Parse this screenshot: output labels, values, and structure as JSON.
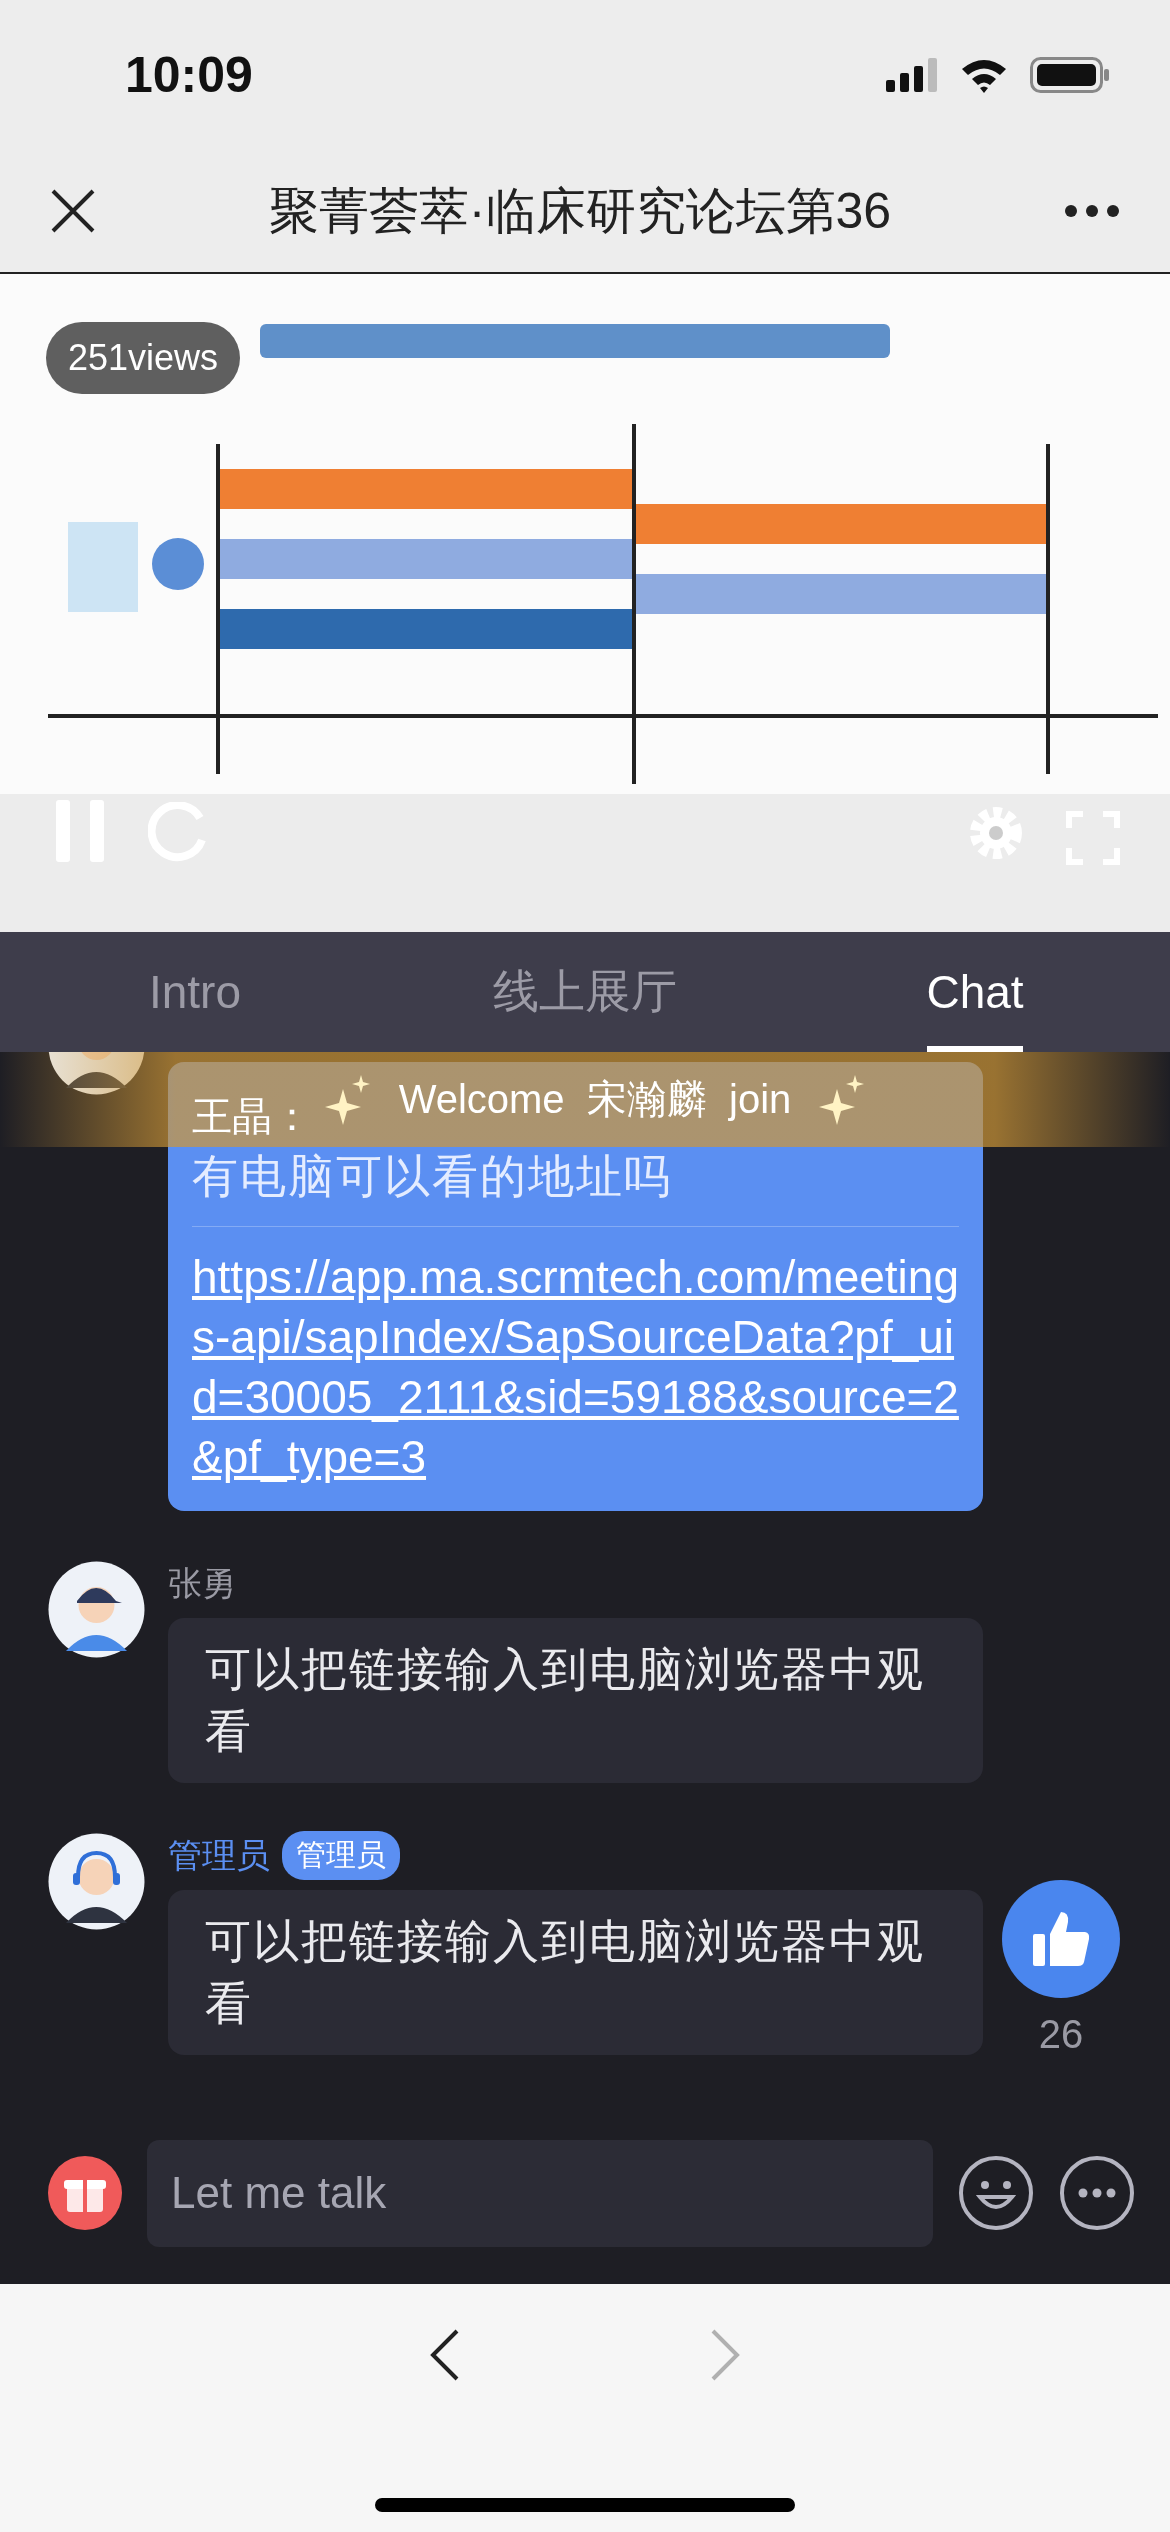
{
  "status_bar": {
    "time": "10:09"
  },
  "nav": {
    "title": "聚菁荟萃·临床研究论坛第36"
  },
  "video": {
    "kind": "picture",
    "views": "251views",
    "playing": true
  },
  "tabs": [
    {
      "label": "Intro",
      "selected": false
    },
    {
      "label": "线上展厅",
      "selected": false
    },
    {
      "label": "Chat",
      "selected": true
    }
  ],
  "welcome": {
    "prefix": "Welcome",
    "name": "宋瀚麟",
    "suffix": "join"
  },
  "messages": [
    {
      "kind": "staff",
      "quote_name": "王晶：",
      "quote_text": "有电脑可以看的地址吗",
      "link": "https://app.ma.scrmtech.com/meetings-api/sapIndex/SapSourceData?pf_uid=30005_2111&sid=59188&source=2&pf_type=3"
    },
    {
      "kind": "user",
      "sender": "张勇",
      "text": "可以把链接输入到电脑浏览器中观看"
    },
    {
      "kind": "staff",
      "sender": "管理员",
      "badge": "管理员",
      "text": "可以把链接输入到电脑浏览器中观看"
    }
  ],
  "like": {
    "count": "26"
  },
  "input": {
    "placeholder": "Let me talk"
  },
  "browser": {
    "back_enabled": true,
    "forward_enabled": false
  }
}
